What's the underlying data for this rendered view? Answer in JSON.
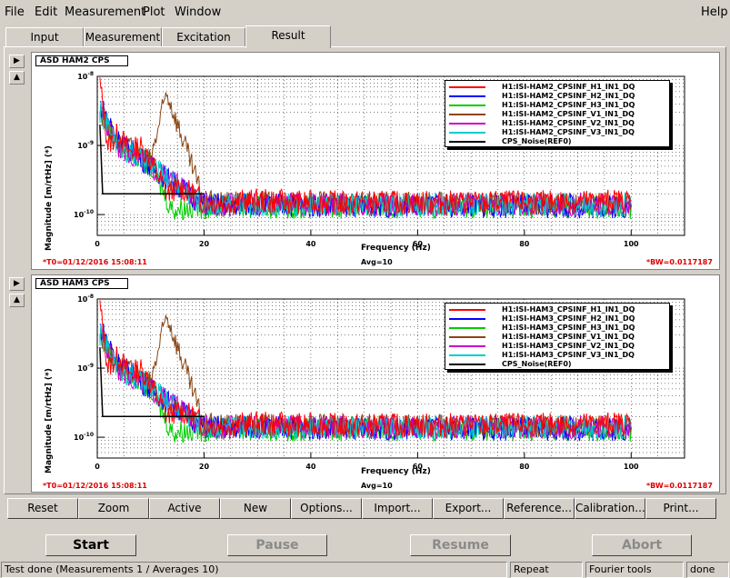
{
  "menu": {
    "file": "File",
    "edit": "Edit",
    "measurement": "Measurement",
    "plot": "Plot",
    "window": "Window",
    "help": "Help"
  },
  "tabs": [
    "Input",
    "Measurement",
    "Excitation",
    "Result"
  ],
  "active_tab": "Result",
  "plots": [
    {
      "title": "ASD HAM2 CPS",
      "ylabel": "Magnitude [m/rtHz] (*)",
      "xlabel": "Frequency (Hz)",
      "t0": "*T0=01/12/2016 15:08:11",
      "avg": "Avg=10",
      "bw": "*BW=0.0117187",
      "legend": [
        {
          "name": "H1:ISI-HAM2_CPSINF_H1_IN1_DQ",
          "color": "#ff0000"
        },
        {
          "name": "H1:ISI-HAM2_CPSINF_H2_IN1_DQ",
          "color": "#0000ff"
        },
        {
          "name": "H1:ISI-HAM2_CPSINF_H3_IN1_DQ",
          "color": "#00cc00"
        },
        {
          "name": "H1:ISI-HAM2_CPSINF_V1_IN1_DQ",
          "color": "#8b4513"
        },
        {
          "name": "H1:ISI-HAM2_CPSINF_V2_IN1_DQ",
          "color": "#cc00cc"
        },
        {
          "name": "H1:ISI-HAM2_CPSINF_V3_IN1_DQ",
          "color": "#00cccc"
        },
        {
          "name": "CPS_Noise(REF0)",
          "color": "#000000"
        }
      ]
    },
    {
      "title": "ASD HAM3 CPS",
      "ylabel": "Magnitude [m/rtHz] (*)",
      "xlabel": "Frequency (Hz)",
      "t0": "*T0=01/12/2016 15:08:11",
      "avg": "Avg=10",
      "bw": "*BW=0.0117187",
      "legend": [
        {
          "name": "H1:ISI-HAM3_CPSINF_H1_IN1_DQ",
          "color": "#ff0000"
        },
        {
          "name": "H1:ISI-HAM3_CPSINF_H2_IN1_DQ",
          "color": "#0000ff"
        },
        {
          "name": "H1:ISI-HAM3_CPSINF_H3_IN1_DQ",
          "color": "#00cc00"
        },
        {
          "name": "H1:ISI-HAM3_CPSINF_V1_IN1_DQ",
          "color": "#8b4513"
        },
        {
          "name": "H1:ISI-HAM3_CPSINF_V2_IN1_DQ",
          "color": "#cc00cc"
        },
        {
          "name": "H1:ISI-HAM3_CPSINF_V3_IN1_DQ",
          "color": "#00cccc"
        },
        {
          "name": "CPS_Noise(REF0)",
          "color": "#000000"
        }
      ]
    }
  ],
  "chart_data": [
    {
      "type": "line",
      "title": "ASD HAM2 CPS",
      "xlabel": "Frequency (Hz)",
      "ylabel": "Magnitude [m/rtHz] (*)",
      "xlim": [
        0,
        110
      ],
      "ylim": [
        5e-11,
        1e-08
      ],
      "yscale": "log",
      "xticks": [
        "0",
        "20",
        "40",
        "60",
        "80",
        "100"
      ],
      "yticks": [
        "10^-10",
        "10^-9",
        "10^-8"
      ],
      "grid": true,
      "legend_position": "top-right",
      "series": [
        {
          "name": "H1:ISI-HAM2_CPSINF_H1_IN1_DQ",
          "x": [
            0.5,
            2,
            4,
            6,
            8,
            10,
            12,
            13,
            15,
            18,
            20,
            30,
            40,
            60,
            80,
            100
          ],
          "values": [
            8e-09,
            1e-09,
            1.5e-09,
            8e-10,
            1e-09,
            6e-10,
            3e-10,
            2e-10,
            2.5e-10,
            2e-10,
            1.5e-10,
            1.6e-10,
            1.5e-10,
            1.5e-10,
            1.5e-10,
            1.6e-10
          ]
        },
        {
          "name": "H1:ISI-HAM2_CPSINF_H2_IN1_DQ",
          "x": [
            0.5,
            4,
            10,
            20,
            100
          ],
          "values": [
            4e-09,
            1.2e-09,
            5e-10,
            1.4e-10,
            1.3e-10
          ]
        },
        {
          "name": "H1:ISI-HAM2_CPSINF_H3_IN1_DQ",
          "x": [
            0.5,
            4,
            10,
            14,
            20,
            100
          ],
          "values": [
            3e-09,
            1e-09,
            5e-10,
            1.2e-10,
            1.3e-10,
            1.3e-10
          ]
        },
        {
          "name": "H1:ISI-HAM2_CPSINF_V1_IN1_DQ",
          "x": [
            0.5,
            4,
            10,
            13,
            20,
            100
          ],
          "values": [
            3e-09,
            1.1e-09,
            6e-10,
            6e-09,
            1.5e-10,
            1.4e-10
          ]
        },
        {
          "name": "H1:ISI-HAM2_CPSINF_V2_IN1_DQ",
          "x": [
            0.5,
            4,
            10,
            20,
            100
          ],
          "values": [
            3e-09,
            1e-09,
            5e-10,
            1.4e-10,
            1.4e-10
          ]
        },
        {
          "name": "H1:ISI-HAM2_CPSINF_V3_IN1_DQ",
          "x": [
            0.5,
            4,
            10,
            20,
            100
          ],
          "values": [
            3e-09,
            1e-09,
            5e-10,
            1.4e-10,
            1.4e-10
          ]
        },
        {
          "name": "CPS_Noise(REF0)",
          "x": [
            0.5,
            1,
            5,
            10,
            20
          ],
          "values": [
            2e-09,
            2e-10,
            2e-10,
            2e-10,
            2e-10
          ]
        }
      ]
    },
    {
      "type": "line",
      "title": "ASD HAM3 CPS",
      "xlabel": "Frequency (Hz)",
      "ylabel": "Magnitude [m/rtHz] (*)",
      "xlim": [
        0,
        110
      ],
      "ylim": [
        5e-11,
        1e-08
      ],
      "yscale": "log",
      "xticks": [
        "0",
        "20",
        "40",
        "60",
        "80",
        "100"
      ],
      "yticks": [
        "10^-10",
        "10^-9",
        "10^-8"
      ],
      "grid": true,
      "legend_position": "top-right",
      "series": [
        {
          "name": "H1:ISI-HAM3_CPSINF_H1_IN1_DQ",
          "x": [
            0.5,
            2,
            4,
            6,
            8,
            10,
            12,
            13,
            15,
            18,
            20,
            30,
            40,
            60,
            80,
            100
          ],
          "values": [
            8e-09,
            1e-09,
            1.5e-09,
            8e-10,
            1e-09,
            6e-10,
            3e-10,
            2e-10,
            2.5e-10,
            2e-10,
            1.5e-10,
            1.6e-10,
            1.5e-10,
            1.5e-10,
            1.5e-10,
            1.6e-10
          ]
        },
        {
          "name": "H1:ISI-HAM3_CPSINF_H2_IN1_DQ",
          "x": [
            0.5,
            4,
            10,
            20,
            100
          ],
          "values": [
            4e-09,
            1.2e-09,
            5e-10,
            1.4e-10,
            1.3e-10
          ]
        },
        {
          "name": "H1:ISI-HAM3_CPSINF_H3_IN1_DQ",
          "x": [
            0.5,
            4,
            10,
            14,
            20,
            100
          ],
          "values": [
            3e-09,
            1e-09,
            5e-10,
            1.2e-10,
            1.3e-10,
            1.3e-10
          ]
        },
        {
          "name": "H1:ISI-HAM3_CPSINF_V1_IN1_DQ",
          "x": [
            0.5,
            4,
            10,
            13,
            20,
            100
          ],
          "values": [
            3e-09,
            1.1e-09,
            6e-10,
            6e-09,
            1.5e-10,
            1.4e-10
          ]
        },
        {
          "name": "H1:ISI-HAM3_CPSINF_V2_IN1_DQ",
          "x": [
            0.5,
            4,
            10,
            20,
            100
          ],
          "values": [
            3e-09,
            1e-09,
            5e-10,
            1.4e-10,
            1.4e-10
          ]
        },
        {
          "name": "H1:ISI-HAM3_CPSINF_V3_IN1_DQ",
          "x": [
            0.5,
            4,
            10,
            20,
            100
          ],
          "values": [
            3e-09,
            1e-09,
            5e-10,
            1.4e-10,
            1.4e-10
          ]
        },
        {
          "name": "CPS_Noise(REF0)",
          "x": [
            0.5,
            1,
            5,
            10,
            20
          ],
          "values": [
            2e-09,
            2e-10,
            2e-10,
            2e-10,
            2e-10
          ]
        }
      ]
    }
  ],
  "toolbar": [
    "Reset",
    "Zoom",
    "Active",
    "New",
    "Options...",
    "Import...",
    "Export...",
    "Reference...",
    "Calibration...",
    "Print..."
  ],
  "controls": {
    "start": "Start",
    "pause": "Pause",
    "resume": "Resume",
    "abort": "Abort"
  },
  "status": {
    "message": "Test done (Measurements 1 / Averages 10)",
    "repeat": "Repeat",
    "tool": "Fourier tools",
    "state": "done"
  }
}
